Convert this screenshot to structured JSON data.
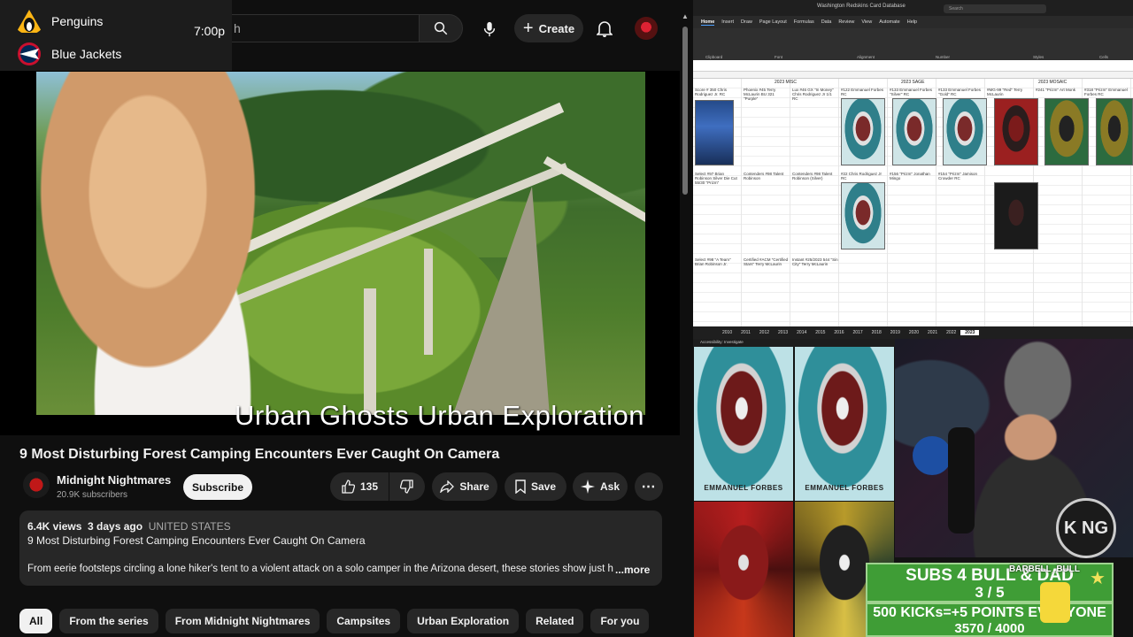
{
  "scores": {
    "team1": "Penguins",
    "team2": "Blue Jackets",
    "time": "7:00p",
    "colors": {
      "team1": "#fcb514",
      "team2": "#002654"
    }
  },
  "youtube": {
    "search_placeholder": "h",
    "create_label": "Create",
    "video_watermark": "Urban Ghosts Urban Exploration",
    "title": "9 Most Disturbing Forest Camping Encounters Ever Caught On Camera",
    "channel_name": "Midnight Nightmares",
    "channel_subs": "20.9K subscribers",
    "subscribe_label": "Subscribe",
    "like_count": "135",
    "share_label": "Share",
    "save_label": "Save",
    "ask_label": "Ask",
    "description": {
      "views": "6.4K views",
      "age": "3 days ago",
      "country": "UNITED STATES",
      "line1": "9 Most Disturbing Forest Camping Encounters Ever Caught On Camera",
      "line2": "From eerie footsteps circling a lone hiker's tent to a violent attack on a solo camper in the Arizona desert, these stories show just h",
      "more": "...more"
    },
    "chips": [
      {
        "label": "All",
        "active": true
      },
      {
        "label": "From the series"
      },
      {
        "label": "From Midnight Nightmares"
      },
      {
        "label": "Campsites"
      },
      {
        "label": "Urban Exploration"
      },
      {
        "label": "Related"
      },
      {
        "label": "For you"
      }
    ],
    "icons": [
      "search-icon",
      "mic-icon",
      "plus-icon",
      "bell-icon",
      "like-icon",
      "dislike-icon",
      "share-icon",
      "save-icon",
      "ask-icon",
      "more-icon"
    ]
  },
  "excel": {
    "window_title": "Washington Redskins Card Database",
    "search_placeholder": "Search",
    "ribbon_tabs": [
      "Home",
      "Insert",
      "Draw",
      "Page Layout",
      "Formulas",
      "Data",
      "Review",
      "View",
      "Automate",
      "Help"
    ],
    "ribbon_groups": [
      "Clipboard",
      "Font",
      "Alignment",
      "Number",
      "Styles",
      "Cells"
    ],
    "sections": [
      "2023 MISC",
      "2023 SAGE",
      "2023 MOSAIC"
    ],
    "row1_cells": [
      "Score # 350 Chris Rodriguez Jr. RC",
      "Phoenix #45 Terry McLaurin BU 321 \"Purple\"",
      "Lux #46 GX \"In Money\" Chris Rodriguez Jr 1/1 RC",
      "#122 Emmanuel Forbes RC",
      "#133 Emmanuel Forbes \"Silver\" RC",
      "#133 Emmanuel Forbes \"Gold\" RC",
      "#MG-99 \"Red\" Terry McLaurin",
      "#241 \"Prizm\" Art Monk",
      "#318 \"Prizm\" Emmanuel Forbes RC"
    ],
    "row2_cells": [
      "Select #97 Brian Robinson Silver Die Cut 55/30 \"Prizm\"",
      "Contenders #98 Talent Robinson",
      "Contenders #98 Talent Robinson (Silver)",
      "#22 Chris Rodriguez Jr RC",
      "#156 \"Prizm\" Jonathan Mingo",
      "#154 \"Prizm\" Jamison Crowder RC"
    ],
    "row3_cells": [
      "Select #98 \"A Team\" Brian Robinson Jr.",
      "Certified #ACM \"Certified Stars\" Terry McLaurin",
      "Instant #25/2023 544 \"Sin City\" Terry McLaurin"
    ],
    "sheet_tabs": [
      "2010",
      "2011",
      "2012",
      "2013",
      "2014",
      "2015",
      "2016",
      "2017",
      "2018",
      "2019",
      "2020",
      "2021",
      "2022",
      "2023"
    ],
    "active_tab": "2023"
  },
  "stream": {
    "bar_label": "Accessibility: Investigate",
    "card_name_1": "EMMANUEL FORBES",
    "card_name_2": "EMMANUEL FORBES",
    "king_logo": "K NG",
    "user_tag": "BARBELL_BULL",
    "goal1_title": "SUBS 4 BULL & DAD",
    "goal1_count": "3 / 5",
    "goal1_progress": 0.6,
    "goal2_title": "500 KICKs=+5 POINTS EVERYONE",
    "goal2_count": "3570 / 4000",
    "goal2_progress": 0.8925,
    "goal_color": "#3f9d36"
  }
}
